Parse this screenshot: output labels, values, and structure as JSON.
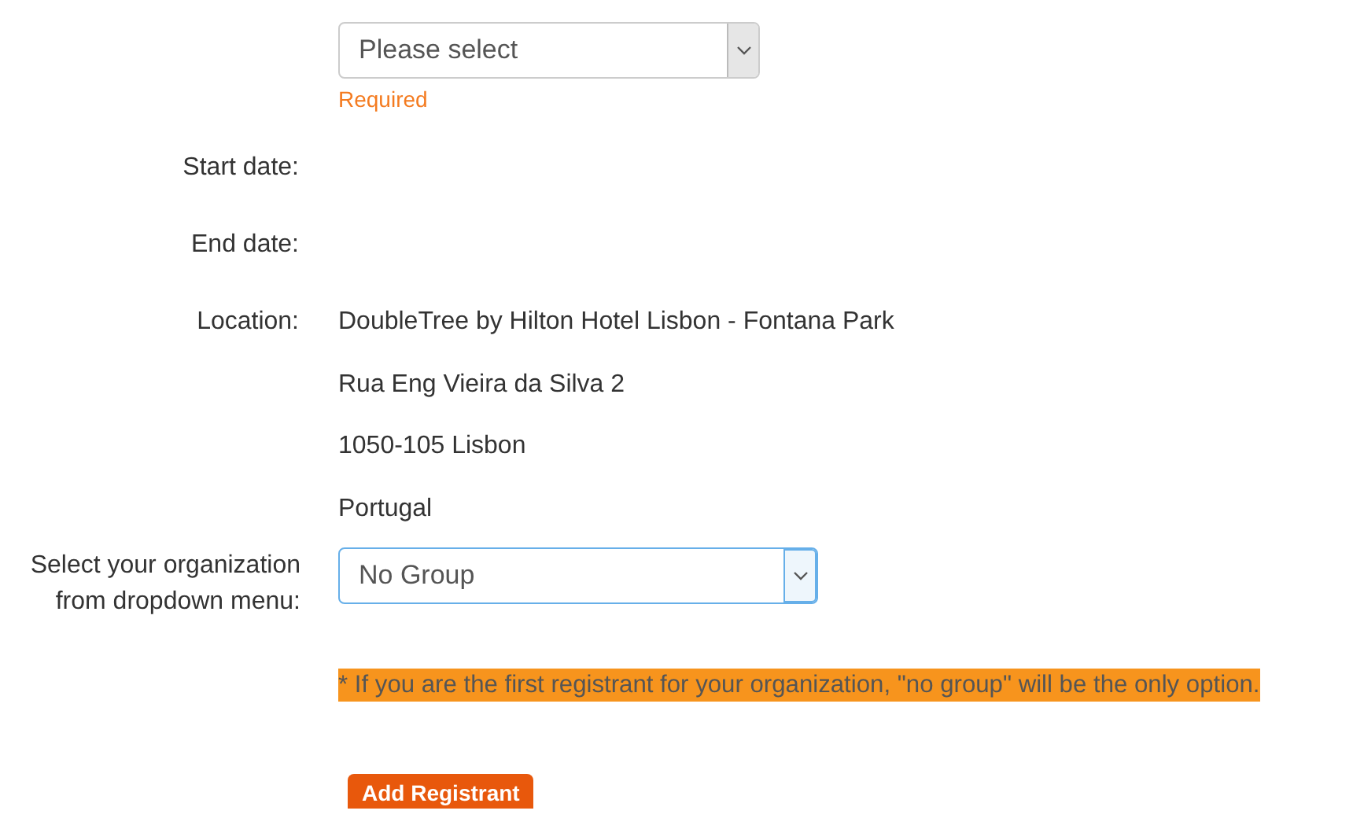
{
  "event_select": {
    "value": "Please select",
    "focused": false,
    "error": "Required"
  },
  "fields": [
    {
      "label": "Start date:"
    },
    {
      "label": "End date:"
    },
    {
      "label": "Location:",
      "lines": [
        "DoubleTree by Hilton Hotel Lisbon - Fontana Park",
        "Rua Eng Vieira da Silva 2",
        "1050-105 Lisbon",
        "Portugal"
      ]
    }
  ],
  "organization": {
    "label": "Select your organization from dropdown menu:",
    "value": "No Group",
    "focused": true
  },
  "note": "* If you are the first registrant for your organization, \"no group\" will be the only option.",
  "button": "Add Registrant"
}
